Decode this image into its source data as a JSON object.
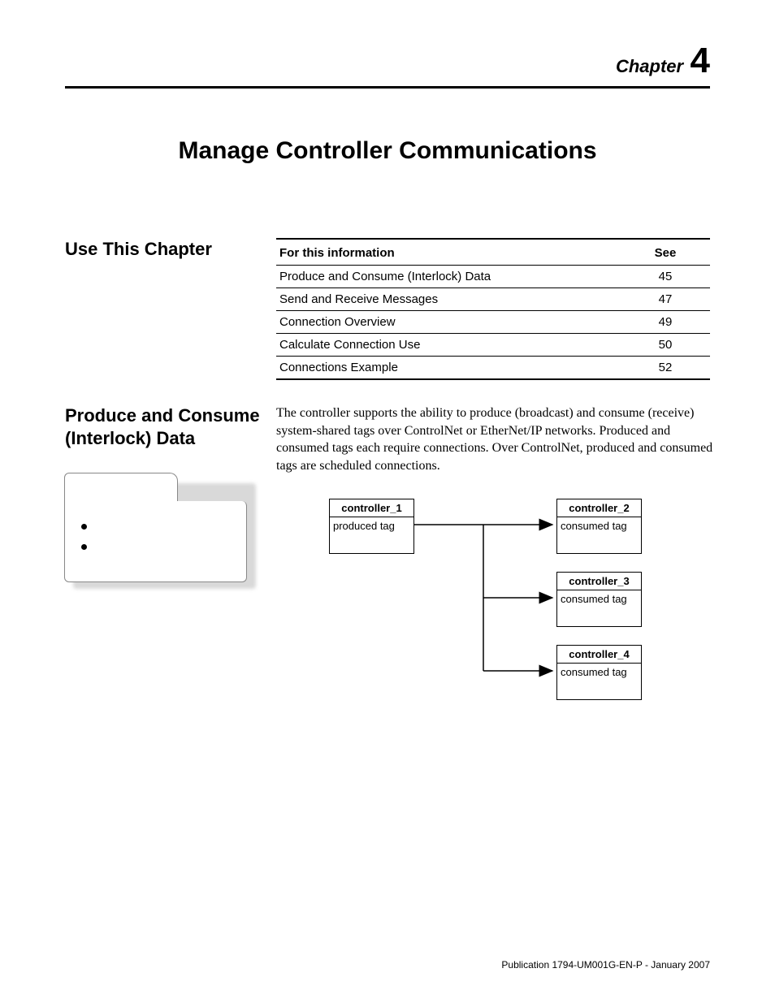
{
  "chapter": {
    "label": "Chapter",
    "number": "4"
  },
  "title": "Manage Controller Communications",
  "sections": {
    "use_this_chapter": {
      "heading": "Use This Chapter"
    },
    "produce_consume": {
      "heading": "Produce and Consume (Interlock) Data",
      "paragraph": "The controller supports the ability to produce (broadcast) and consume (receive) system-shared tags over ControlNet or EtherNet/IP networks. Produced and consumed tags each require connections. Over ControlNet, produced and consumed tags are scheduled connections."
    }
  },
  "toc": {
    "col_info": "For this information",
    "col_see": "See",
    "rows": [
      {
        "info": "Produce and Consume (Interlock) Data",
        "page": "45"
      },
      {
        "info": "Send and Receive Messages",
        "page": "47"
      },
      {
        "info": "Connection Overview",
        "page": "49"
      },
      {
        "info": "Calculate Connection Use",
        "page": "50"
      },
      {
        "info": "Connections Example",
        "page": "52"
      }
    ]
  },
  "diagram": {
    "boxes": {
      "c1": {
        "title": "controller_1",
        "tag": "produced tag"
      },
      "c2": {
        "title": "controller_2",
        "tag": "consumed tag"
      },
      "c3": {
        "title": "controller_3",
        "tag": "consumed tag"
      },
      "c4": {
        "title": "controller_4",
        "tag": "consumed tag"
      }
    }
  },
  "footer": "Publication 1794-UM001G-EN-P - January 2007"
}
